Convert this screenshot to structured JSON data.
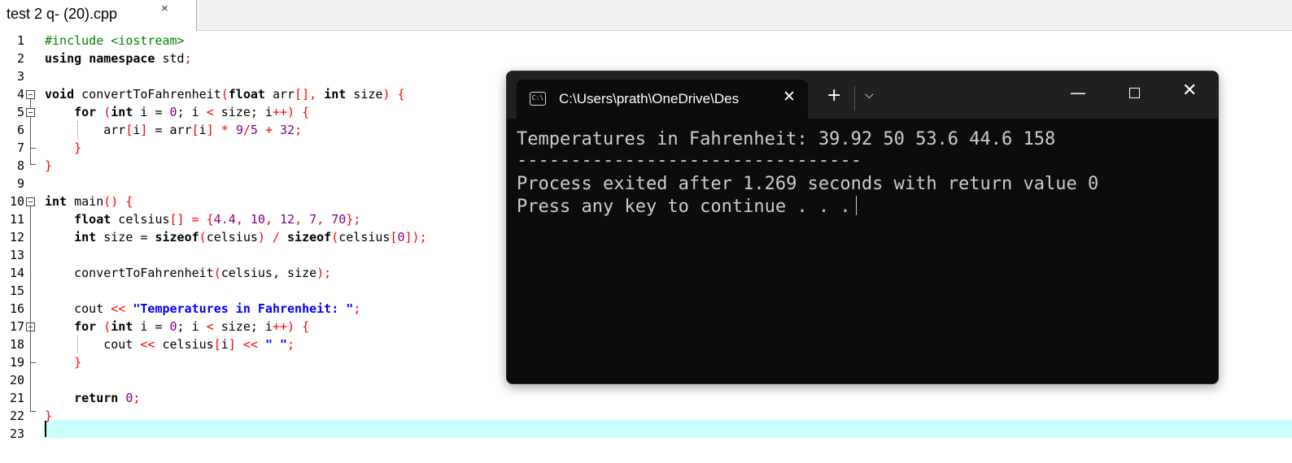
{
  "editor": {
    "tab_title": "test 2 q- (20).cpp",
    "tab_close": "×",
    "line_numbers": [
      "1",
      "2",
      "3",
      "4",
      "5",
      "6",
      "7",
      "8",
      "9",
      "10",
      "11",
      "12",
      "13",
      "14",
      "15",
      "16",
      "17",
      "18",
      "19",
      "20",
      "21",
      "22",
      "23"
    ],
    "lines": {
      "l1_pp": "#include <iostream>",
      "l2_kw1": "using",
      "l2_kw2": "namespace",
      "l2_rest": " std",
      "l4_kw1": "void",
      "l4_name": " convertToFahrenheit",
      "l4_kw2": "float",
      "l4_arr": " arr",
      "l4_kw3": "int",
      "l4_size": " size",
      "l5_kw1": "for",
      "l5_kw2": "int",
      "l5_i1": " i = ",
      "l5_n0": "0",
      "l5_c1": "; i ",
      "l5_c2": " size; i",
      "l6_a1": "arr",
      "l6_a2": "i",
      "l6_a3": " = arr",
      "l6_a4": "i",
      "l6_n9": "9",
      "l6_n5": "5",
      "l6_n32": "32",
      "l11_kw": "float",
      "l11_name": " celsius",
      "l11_n1": "4.4",
      "l11_n2": "10",
      "l11_n3": "12",
      "l11_n4": "7",
      "l11_n5": "70",
      "l12_kw1": "int",
      "l12_a": " size = ",
      "l12_kw2": "sizeof",
      "l12_c1": "celsius",
      "l12_kw3": "sizeof",
      "l12_c2": "celsius",
      "l12_n0": "0",
      "l14_call": "convertToFahrenheit",
      "l14_args": "celsius, size",
      "l16_cout": "cout ",
      "l16_str": "\"Temperatures in Fahrenheit: \"",
      "l17_kw1": "for",
      "l17_kw2": "int",
      "l17_i1": " i = ",
      "l17_n0": "0",
      "l17_c1": "; i ",
      "l17_c2": " size; i",
      "l18_cout": "cout ",
      "l18_c": " celsius",
      "l18_i": "i",
      "l18_str": "\" \"",
      "l21_kw": "return",
      "l21_n0": "0"
    }
  },
  "console": {
    "tab_title": "C:\\Users\\prath\\OneDrive\\Des",
    "close_glyph": "✕",
    "plus_glyph": "+",
    "chevron_glyph": "⌵",
    "min_glyph": "—",
    "win_close_glyph": "✕",
    "output": [
      "Temperatures in Fahrenheit: 39.92 50 53.6 44.6 158",
      "--------------------------------",
      "Process exited after 1.269 seconds with return value 0",
      "Press any key to continue . . ."
    ],
    "icons": [
      "terminal-icon"
    ]
  }
}
